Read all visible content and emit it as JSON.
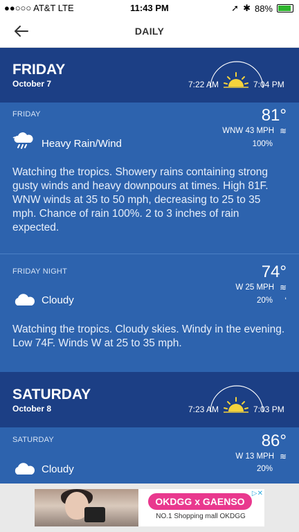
{
  "status": {
    "carrier": "●●○○○ AT&T  LTE",
    "time": "11:43 PM",
    "battery": "88%",
    "battery_level": 0.88
  },
  "nav": {
    "title": "DAILY"
  },
  "days": [
    {
      "name": "FRIDAY",
      "date": "October 7",
      "sunrise": "7:22 AM",
      "sunset": "7:04 PM",
      "periods": [
        {
          "label": "FRIDAY",
          "temp": "81°",
          "wind": "WNW 43 MPH",
          "precip": "100%",
          "condition": "Heavy Rain/Wind",
          "icon": "rain-wind-icon",
          "description": "Watching the tropics. Showery rains containing strong gusty winds and heavy downpours at times. High 81F. WNW winds at 35 to 50 mph, decreasing to 25 to 35 mph. Chance of rain 100%. 2 to 3 inches of rain expected."
        },
        {
          "label": "FRIDAY NIGHT",
          "temp": "74°",
          "wind": "W 25 MPH",
          "precip": "20%",
          "condition": "Cloudy",
          "icon": "cloud-icon",
          "description": "Watching the tropics. Cloudy skies. Windy in the evening. Low 74F. Winds W at 25 to 35 mph."
        }
      ]
    },
    {
      "name": "SATURDAY",
      "date": "October 8",
      "sunrise": "7:23 AM",
      "sunset": "7:03 PM",
      "periods": [
        {
          "label": "SATURDAY",
          "temp": "86°",
          "wind": "W 13 MPH",
          "precip": "20%",
          "condition": "Cloudy",
          "icon": "cloud-icon"
        }
      ]
    }
  ],
  "ad": {
    "headline": "OKDGG x GAENSO",
    "tagline": "NO.1 Shopping mall OKDGG",
    "adchoices": "▷✕"
  },
  "colors": {
    "header_bg": "#1c3f85",
    "panel_bg": "#2d63ae",
    "sun": "#f4d23c",
    "ad_pink": "#e9388e"
  }
}
